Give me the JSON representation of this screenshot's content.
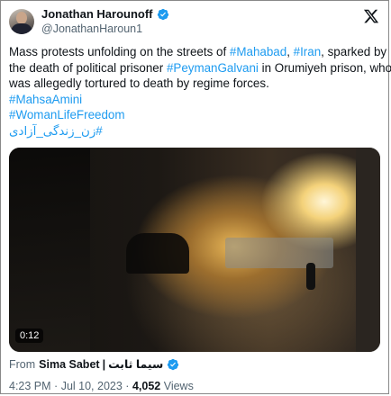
{
  "author": {
    "display_name": "Jonathan Harounoff",
    "handle": "@JonathanHaroun1"
  },
  "tweet": {
    "segments_line1": [
      "Mass protests unfolding on the streets of ",
      "#Mahabad",
      ", ",
      "#Iran",
      ", sparked by"
    ],
    "line2_a": "the death of political prisoner ",
    "line2_tag": "#PeymanGalvani",
    "line2_b": " in Orumiyeh prison, who",
    "line3": "was allegedly tortured to death by regime forces.",
    "hashtag1": "#MahsaAmini",
    "hashtag2": "#WomanLifeFreedom",
    "hashtag3": "#زن_زندگی_آزادی"
  },
  "video": {
    "duration": "0:12"
  },
  "source": {
    "prefix": "From",
    "name": "Sima Sabet",
    "separator": "|",
    "name_fa": "سیما ثابت"
  },
  "meta": {
    "time": "4:23 PM",
    "dot1": "·",
    "date": "Jul 10, 2023",
    "dot2": "·",
    "views": "4,052",
    "views_label": "Views"
  },
  "colors": {
    "link": "#1d9bf0",
    "verified": "#1d9bf0",
    "text": "#0f1419",
    "muted": "#536471"
  },
  "icons": [
    "verified-badge-icon",
    "x-logo-icon"
  ]
}
